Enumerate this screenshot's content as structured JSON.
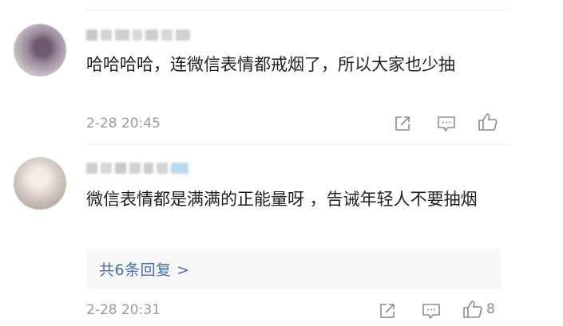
{
  "comments": [
    {
      "text": "哈哈哈哈，连微信表情都戒烟了，所以大家也少抽",
      "time": "2-28 20:45",
      "actions": {
        "share_icon": "share-icon",
        "reply_icon": "comment-icon",
        "like_icon": "thumbs-up-icon"
      }
    },
    {
      "text": "微信表情都是满满的正能量呀 ，告诫年轻人不要抽烟",
      "time": "2-28 20:31",
      "replies_label": "共6条回复 >",
      "like_count": "8",
      "actions": {
        "share_icon": "share-icon",
        "reply_icon": "comment-icon",
        "like_icon": "thumbs-up-icon"
      }
    }
  ],
  "colors": {
    "text": "#1f1f1f",
    "meta": "#9a9a9a",
    "link": "#4b6fa8",
    "reply_bg": "#f7f7f7"
  }
}
